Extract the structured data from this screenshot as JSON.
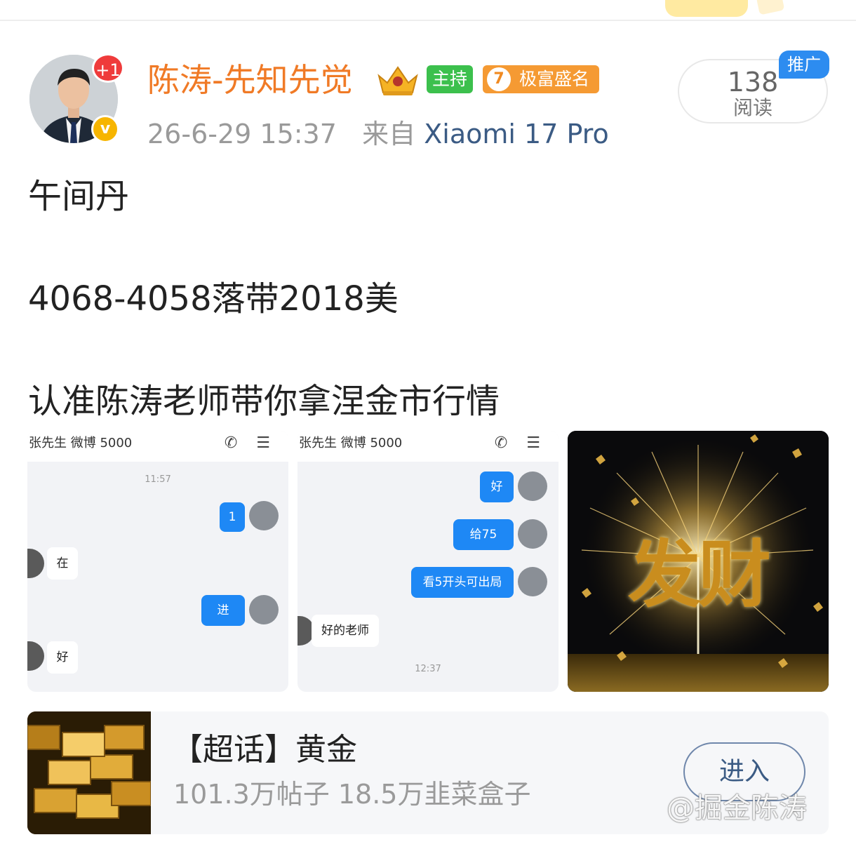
{
  "post": {
    "author": {
      "name": "陈涛-先知先觉",
      "plus_badge": "+1",
      "verified_badge": "v",
      "host_badge": "主持",
      "rank_level": "7",
      "rank_title": "极富盛名"
    },
    "date": "26-6-29 15:37",
    "source_prefix": "来自",
    "device": "Xiaomi 17 Pro",
    "read_count": "138",
    "read_label": "阅读",
    "promo_label": "推广",
    "lines": [
      "午间丹",
      "4068-4058落带2018美",
      "认准陈涛老师带你拿涅金市行情"
    ]
  },
  "images": {
    "chat1": {
      "header": "张先生 微博  5000",
      "header_icons": "✆ ☰",
      "time": "11:57",
      "messages": [
        {
          "from": "me",
          "text": "1"
        },
        {
          "from": "other",
          "text": "在"
        },
        {
          "from": "me",
          "text": "进"
        },
        {
          "from": "other",
          "text": "好"
        }
      ]
    },
    "chat2": {
      "header": "张先生 微博  5000",
      "header_icons": "✆ ☰",
      "time": "12:37",
      "messages": [
        {
          "from": "me",
          "text": "好"
        },
        {
          "from": "me",
          "text": "给75"
        },
        {
          "from": "me",
          "text": "看5开头可出局"
        },
        {
          "from": "other",
          "text": "好的老师"
        }
      ]
    },
    "firework": {
      "text": "发财"
    }
  },
  "topic": {
    "title": "【超话】黄金",
    "stats": "101.3万帖子 18.5万韭菜盒子",
    "enter_label": "进入"
  },
  "watermark": "@掘金陈涛",
  "colors": {
    "username": "#f07a26",
    "host_badge": "#3cc04d",
    "rank_badge": "#f59a33",
    "promo": "#2d8cf0",
    "chat_bubble": "#1e88f5",
    "device_link": "#3b5b84"
  }
}
